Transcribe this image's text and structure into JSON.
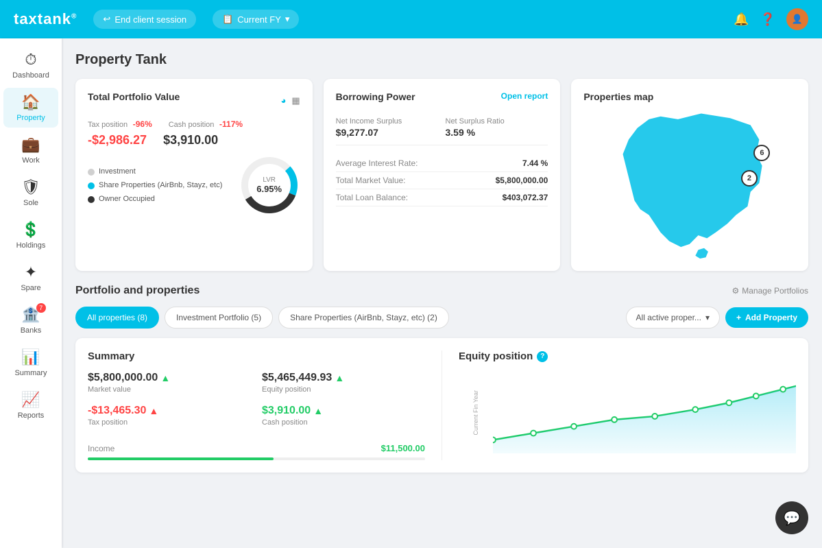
{
  "header": {
    "logo": "taxtank",
    "logo_r": "®",
    "end_session_label": "End client session",
    "current_fy_label": "Current FY"
  },
  "sidebar": {
    "items": [
      {
        "id": "dashboard",
        "label": "Dashboard",
        "icon": "⏱",
        "active": false
      },
      {
        "id": "property",
        "label": "Property",
        "icon": "🏠",
        "active": true
      },
      {
        "id": "work",
        "label": "Work",
        "icon": "💼",
        "active": false
      },
      {
        "id": "sole",
        "label": "Sole",
        "icon": "🛡",
        "active": false
      },
      {
        "id": "holdings",
        "label": "Holdings",
        "icon": "💲",
        "active": false
      },
      {
        "id": "spare",
        "label": "Spare",
        "icon": "✦",
        "active": false
      },
      {
        "id": "banks",
        "label": "Banks",
        "icon": "🏦",
        "active": false,
        "badge": "7"
      },
      {
        "id": "summary",
        "label": "Summary",
        "icon": "📊",
        "active": false
      },
      {
        "id": "reports",
        "label": "Reports",
        "icon": "📈",
        "active": false
      }
    ]
  },
  "page": {
    "title": "Property Tank"
  },
  "portfolio_card": {
    "title": "Total Portfolio Value",
    "tax_label": "Tax position",
    "tax_value": "-96%",
    "cash_label": "Cash position",
    "cash_value": "-117%",
    "main_value": "-$2,986.27",
    "cash_main_value": "$3,910.00",
    "legend": [
      {
        "label": "Investment",
        "color": "gray"
      },
      {
        "label": "Share Properties (AirBnb, Stayz, etc)",
        "color": "blue"
      },
      {
        "label": "Owner Occupied",
        "color": "dark"
      }
    ],
    "donut_label": "LVR",
    "donut_value": "6.95%"
  },
  "borrowing_card": {
    "title": "Borrowing Power",
    "open_report": "Open report",
    "net_income_label": "Net Income Surplus",
    "net_income_value": "$9,277.07",
    "net_surplus_label": "Net Surplus Ratio",
    "net_surplus_value": "3.59 %",
    "avg_interest_label": "Average Interest Rate:",
    "avg_interest_value": "7.44 %",
    "total_market_label": "Total Market Value:",
    "total_market_value": "$5,800,000.00",
    "total_loan_label": "Total Loan Balance:",
    "total_loan_value": "$403,072.37"
  },
  "map_card": {
    "title": "Properties map",
    "marker1": {
      "value": "6",
      "top": "32%",
      "left": "88%"
    },
    "marker2": {
      "value": "2",
      "top": "48%",
      "left": "83%"
    }
  },
  "portfolio_section": {
    "title": "Portfolio and properties",
    "manage_label": "Manage Portfolios",
    "tabs": [
      {
        "label": "All properties (8)",
        "active": true
      },
      {
        "label": "Investment Portfolio (5)",
        "active": false
      },
      {
        "label": "Share Properties (AirBnb, Stayz, etc) (2)",
        "active": false
      }
    ],
    "dropdown_label": "All active proper...",
    "add_property_label": "Add Property"
  },
  "summary_section": {
    "title": "Summary",
    "market_value": "$5,800,000.00",
    "market_label": "Market value",
    "equity_position": "$5,465,449.93",
    "equity_label": "Equity position",
    "tax_position": "-$13,465.30",
    "tax_label": "Tax position",
    "cash_position": "$3,910.00",
    "cash_label": "Cash position",
    "income_label": "Income",
    "income_value": "$11,500.00",
    "income_progress": 55
  },
  "equity_section": {
    "title": "Equity position",
    "axis_label": "Current Fin Year"
  }
}
